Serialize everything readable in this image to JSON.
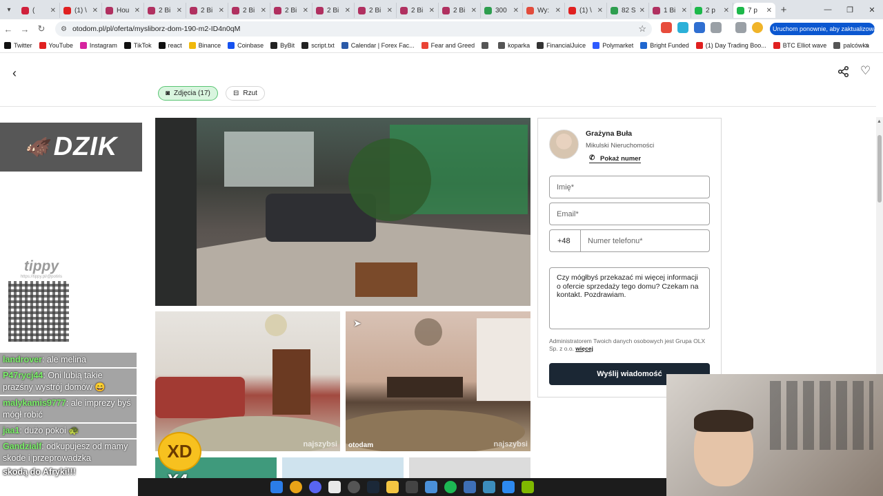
{
  "browser": {
    "tabs": [
      {
        "label": "(",
        "fav": "#d0203b"
      },
      {
        "label": "(1) \\",
        "fav": "#e02020"
      },
      {
        "label": "Hou",
        "fav": "#b03060"
      },
      {
        "label": "2 Bi",
        "fav": "#b03060"
      },
      {
        "label": "2 Bi",
        "fav": "#b03060"
      },
      {
        "label": "2 Bi",
        "fav": "#b03060"
      },
      {
        "label": "2 Bi",
        "fav": "#b03060"
      },
      {
        "label": "2 Bi",
        "fav": "#b03060"
      },
      {
        "label": "2 Bi",
        "fav": "#b03060"
      },
      {
        "label": "2 Bi",
        "fav": "#b03060"
      },
      {
        "label": "2 Bi",
        "fav": "#b03060"
      },
      {
        "label": "300",
        "fav": "#2e9e4f"
      },
      {
        "label": "Wy:",
        "fav": "#e24c3c"
      },
      {
        "label": "(1) \\",
        "fav": "#e02020"
      },
      {
        "label": "82 S",
        "fav": "#2e9e4f"
      },
      {
        "label": "1 Bi",
        "fav": "#b03060"
      },
      {
        "label": "2 p",
        "fav": "#1cb84a"
      },
      {
        "label": "7 p",
        "fav": "#1cb84a",
        "active": true
      }
    ],
    "new_tab": "+",
    "url": "otodom.pl/pl/oferta/mysliborz-dom-190-m2-ID4n0qM",
    "restart_label": "Uruchom ponownie, aby zaktualizować",
    "bookmarks": [
      {
        "label": "Twitter",
        "color": "#111111"
      },
      {
        "label": "YouTube",
        "color": "#e02020"
      },
      {
        "label": "Instagram",
        "color": "#d6249f"
      },
      {
        "label": "TikTok",
        "color": "#111111"
      },
      {
        "label": "react",
        "color": "#111111"
      },
      {
        "label": "Binance",
        "color": "#f0b90b"
      },
      {
        "label": "Coinbase",
        "color": "#1652f0"
      },
      {
        "label": "ByBit",
        "color": "#222222"
      },
      {
        "label": "script.txt",
        "color": "#222222"
      },
      {
        "label": "Calendar | Forex Fac...",
        "color": "#2b5aa8"
      },
      {
        "label": "Fear and Greed",
        "color": "#ea4335"
      },
      {
        "label": "",
        "color": "#555555"
      },
      {
        "label": "koparka",
        "color": "#555555"
      },
      {
        "label": "FinancialJuice",
        "color": "#333333"
      },
      {
        "label": "Polymarket",
        "color": "#2e5bff"
      },
      {
        "label": "Bright Funded",
        "color": "#1e66d0"
      },
      {
        "label": "(1) Day Trading Boo...",
        "color": "#e02020"
      },
      {
        "label": "BTC Elliot wave",
        "color": "#e02020"
      },
      {
        "label": "palcówka",
        "color": "#555555"
      }
    ]
  },
  "page": {
    "photos_pill": "Zdjęcia (17)",
    "plan_pill": "Rzut",
    "accent": "#58c472",
    "watermark": "najszybsi",
    "watermark_otodom": "otodam"
  },
  "agent": {
    "name": "Grażyna Buła",
    "agency": "Mikulski Nieruchomości",
    "show_number": "Pokaż numer"
  },
  "form": {
    "name_placeholder": "Imię*",
    "email_placeholder": "Email*",
    "prefix": "+48",
    "phone_placeholder": "Numer telefonu*",
    "message": "Czy mógłbyś przekazać mi więcej informacji o ofercie sprzedaży tego domu? Czekam na kontakt. Pozdrawiam.",
    "consent_text": "Administratorem Twoich danych osobowych jest Grupa OLX Sp. z o.o.",
    "consent_link": "więcej",
    "send_label": "Wyślij wiadomość",
    "button_color": "#1b2734"
  },
  "stream": {
    "sponsor": "DZIK",
    "tippy_brand": "tippy",
    "tippy_url": "https://tippy.pl/@potiris",
    "chat": [
      {
        "nick": "landrover",
        "text": ": ale melina"
      },
      {
        "nick": "P47rycj44",
        "text": ": Oni lubią takie prazśny wystrój domów 😄"
      },
      {
        "nick": "malykamis9777",
        "text": ": ale imprezy byś mógł robić"
      },
      {
        "nick": "jaa1",
        "text": ": dużo pokoi 🐢"
      },
      {
        "nick": "Gandzialf",
        "text": ": odkupujesz od mamy skode i przeprowadzka"
      }
    ],
    "overlay_text": "skodą do Afryki!!!",
    "emote_multiplier": "X4"
  }
}
